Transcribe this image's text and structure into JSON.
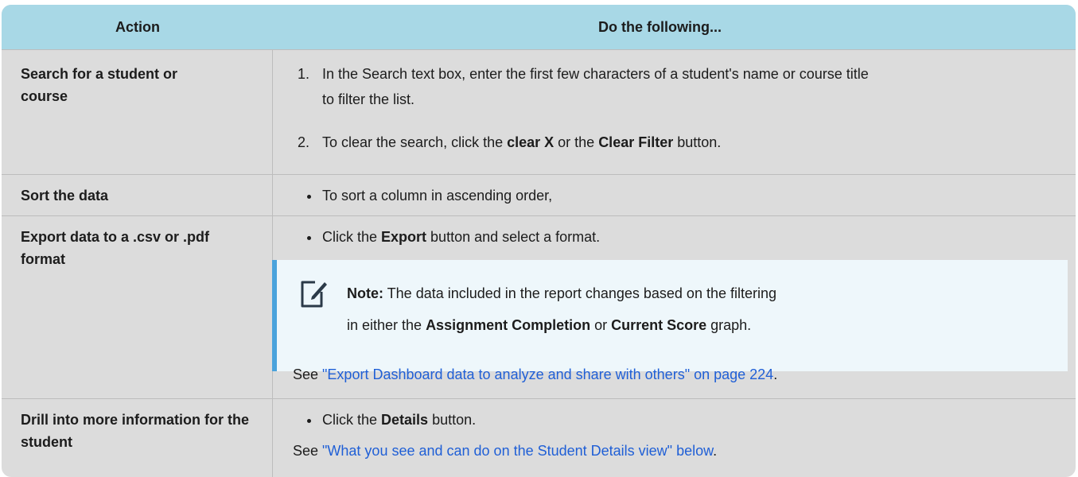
{
  "table": {
    "headers": {
      "action": "Action",
      "do": "Do the following..."
    },
    "rows": [
      {
        "action": "Search for a student or course",
        "steps": [
          {
            "number": "1.",
            "text_line1": "In the Search text box, enter the first few characters of a student's name or course title",
            "text_line2": "to filter the list."
          },
          {
            "number": "2.",
            "pre": "To clear the search, click the ",
            "bold1": "clear X",
            "mid": " or the ",
            "bold2": "Clear Filter",
            "post": " button."
          }
        ]
      },
      {
        "action": "Sort the data",
        "bullet": "To sort a column in ascending order,"
      },
      {
        "action": "Export data to a .csv or .pdf format",
        "bullet_pre": "Click the ",
        "bullet_bold": "Export",
        "bullet_post": " button and select a format.",
        "note": {
          "label": "Note:",
          "line1": " The data included in the report changes based on the filtering",
          "line2_pre": "in either the ",
          "line2_bold1": "Assignment Completion",
          "line2_mid": " or ",
          "line2_bold2": "Current Score",
          "line2_post": " graph."
        },
        "see_pre": "See ",
        "see_link": "\"Export Dashboard data to analyze and share with others\" on page 224",
        "see_post": "."
      },
      {
        "action": "Drill into more information for the student",
        "bullet_pre": "Click the ",
        "bullet_bold": "Details",
        "bullet_post": " button.",
        "see_pre": "See ",
        "see_link": "\"What you see and can do on the Student Details view\" below",
        "see_post": "."
      }
    ]
  },
  "colors": {
    "header_bg": "#a8d8e6",
    "body_bg": "#dcdcdc",
    "link": "#1f5fd6",
    "note_bar": "#4aa3dc"
  },
  "icons": {
    "note": "note-edit-icon"
  }
}
